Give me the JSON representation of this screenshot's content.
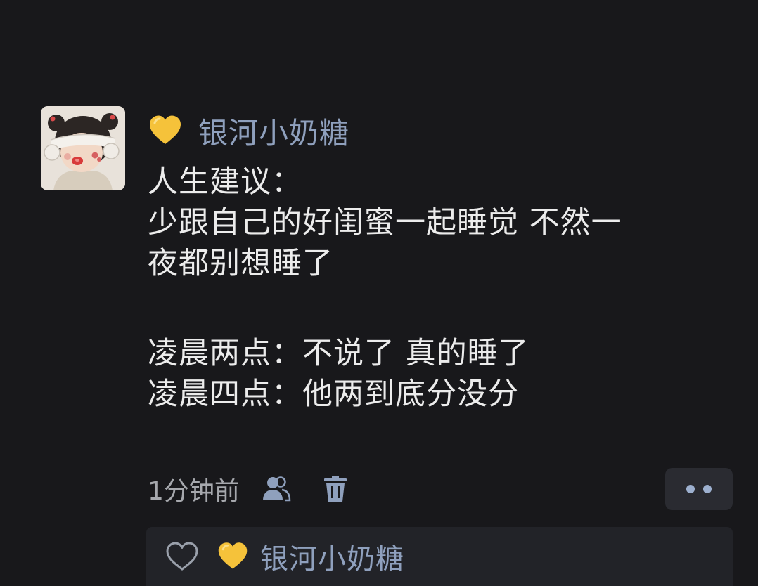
{
  "post": {
    "author": {
      "name": "银河小奶糖",
      "avatar_icon": "avatar-girl-headphones-icon",
      "badge_icon": "yellow-heart-icon",
      "badge_color": "#f5c23a"
    },
    "lines": [
      "人生建议：",
      "少跟自己的好闺蜜一起睡觉 不然一",
      "夜都别想睡了",
      "",
      "凌晨两点：不说了 真的睡了",
      "凌晨四点：他两到底分没分"
    ],
    "timestamp": "1分钟前",
    "icons": {
      "visibility": "friends-icon",
      "delete": "trash-icon",
      "more": "more-dots-icon"
    }
  },
  "likes": {
    "like_icon": "heart-outline-icon",
    "likers": [
      {
        "name": "银河小奶糖",
        "badge_icon": "yellow-heart-icon"
      }
    ]
  },
  "colors": {
    "background": "#18181b",
    "name_blue": "#8fa0bd",
    "text": "#ececec",
    "meta_gray": "#a6a8ad",
    "panel": "#222328"
  }
}
